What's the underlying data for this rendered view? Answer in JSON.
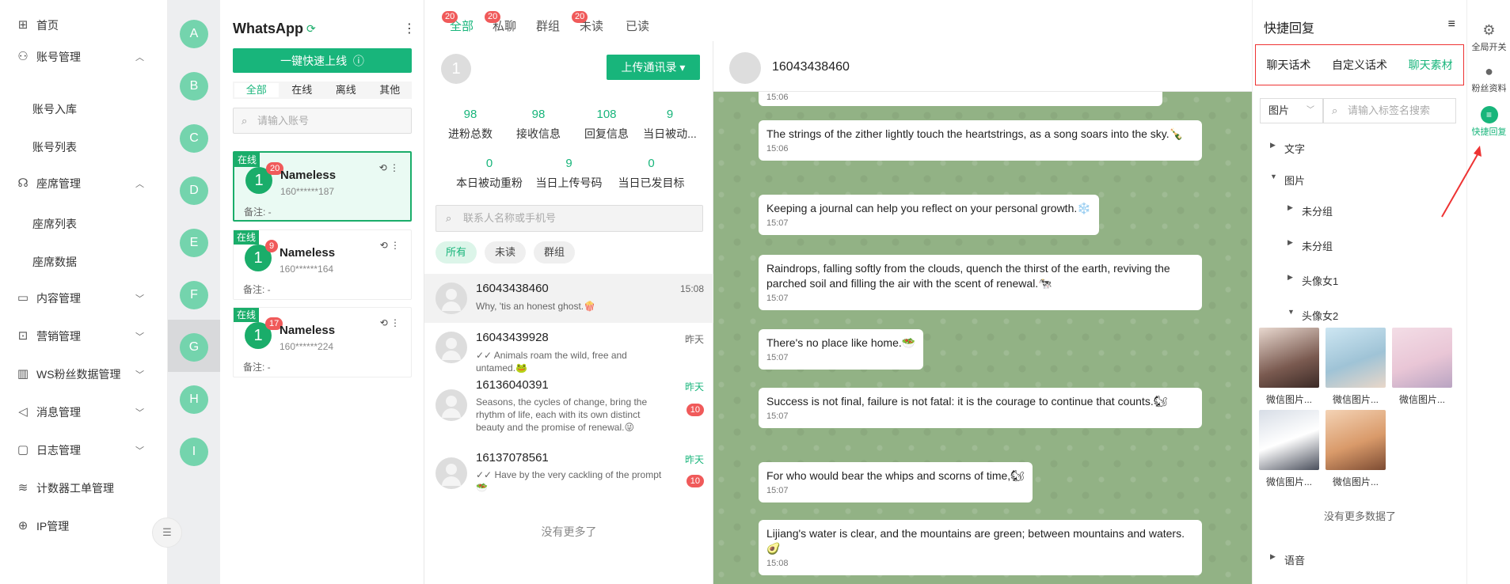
{
  "menu": {
    "home": "首页",
    "account_mgmt": "账号管理",
    "account_import": "账号入库",
    "account_list": "账号列表",
    "seat_mgmt": "座席管理",
    "seat_list": "座席列表",
    "seat_data": "座席数据",
    "content_mgmt": "内容管理",
    "marketing_mgmt": "营销管理",
    "ws_fans_mgmt": "WS粉丝数据管理",
    "message_mgmt": "消息管理",
    "log_mgmt": "日志管理",
    "counter_ticket_mgmt": "计数器工单管理",
    "ip_mgmt": "IP管理"
  },
  "letters": [
    "A",
    "B",
    "C",
    "D",
    "E",
    "F",
    "G",
    "H",
    "I"
  ],
  "accounts": {
    "title": "WhatsApp",
    "quick_online": "一键快速上线",
    "tabs": [
      "全部",
      "在线",
      "离线",
      "其他"
    ],
    "search_placeholder": "请输入账号",
    "cards": [
      {
        "status": "在线",
        "avatar": "1",
        "badge": "20",
        "name": "Nameless",
        "phone": "160******187",
        "note": "备注: -"
      },
      {
        "status": "在线",
        "avatar": "1",
        "badge": "9",
        "name": "Nameless",
        "phone": "160******164",
        "note": "备注: -"
      },
      {
        "status": "在线",
        "avatar": "1",
        "badge": "17",
        "name": "Nameless",
        "phone": "160******224",
        "note": "备注: -"
      }
    ]
  },
  "top_tabs": [
    {
      "label": "全部",
      "badge": "20"
    },
    {
      "label": "私聊",
      "badge": "20"
    },
    {
      "label": "群组",
      "badge": ""
    },
    {
      "label": "未读",
      "badge": "20"
    },
    {
      "label": "已读",
      "badge": ""
    }
  ],
  "list": {
    "avatar": "1",
    "upload_label": "上传通讯录",
    "stats": [
      {
        "value": "98",
        "label": "进粉总数"
      },
      {
        "value": "98",
        "label": "接收信息"
      },
      {
        "value": "108",
        "label": "回复信息"
      },
      {
        "value": "9",
        "label": "当日被动..."
      },
      {
        "value": "0",
        "label": "本日被动重粉"
      },
      {
        "value": "9",
        "label": "当日上传号码"
      },
      {
        "value": "0",
        "label": "当日已发目标"
      }
    ],
    "search_placeholder": "联系人名称或手机号",
    "filters": [
      "所有",
      "未读",
      "群组"
    ],
    "conversations": [
      {
        "name": "16043438460",
        "time": "15:08",
        "msg": "Why, 'tis an honest ghost.🍿",
        "unread": ""
      },
      {
        "name": "16043439928",
        "time": "昨天",
        "msg": "✓✓ Animals roam the wild, free and untamed.🐸",
        "unread": ""
      },
      {
        "name": "16136040391",
        "time": "昨天",
        "msg": "Seasons, the cycles of change, bring the rhythm of life, each with its own distinct beauty and the promise of renewal.😜",
        "unread": "10"
      },
      {
        "name": "16137078561",
        "time": "昨天",
        "msg": "✓✓ Have by the very cackling of the prompt 🥗",
        "unread": "10"
      }
    ],
    "no_more": "没有更多了"
  },
  "chat": {
    "contact": "16043438460",
    "messages": [
      {
        "text": "",
        "time": "15:06"
      },
      {
        "text": "The strings of the zither lightly touch the heartstrings, as a song soars into the sky.🍾",
        "time": "15:06"
      },
      {
        "text": "Keeping a journal can help you reflect on your personal growth.❄️",
        "time": "15:07"
      },
      {
        "text": "Raindrops, falling softly from the clouds, quench the thirst of the earth, reviving the parched soil and filling the air with the scent of renewal.🐄",
        "time": "15:07"
      },
      {
        "text": "There's no place like home.🥗",
        "time": "15:07"
      },
      {
        "text": "Success is not final, failure is not fatal: it is the courage to continue that counts.🐿",
        "time": "15:07"
      },
      {
        "text": "For who would bear the whips and scorns of time,🐿",
        "time": "15:07"
      },
      {
        "text": "Lijiang's water is clear, and the mountains are green; between mountains and waters.🥑",
        "time": "15:08"
      }
    ]
  },
  "quick_reply": {
    "title": "快捷回复",
    "tabs": [
      "聊天话术",
      "自定义话术",
      "聊天素材"
    ],
    "select_value": "图片",
    "search_placeholder": "请输入标签名搜索",
    "tree": {
      "text": "文字",
      "image": "图片",
      "ungrouped1": "未分组",
      "ungrouped2": "未分组",
      "avatar_f1": "头像女1",
      "avatar_f2": "头像女2",
      "voice": "语音"
    },
    "thumbs": [
      "微信图片...",
      "微信图片...",
      "微信图片...",
      "微信图片...",
      "微信图片..."
    ],
    "no_more": "没有更多数据了"
  },
  "rail": {
    "global_switch": "全局开关",
    "fans_profile": "粉丝资料",
    "quick_reply": "快捷回复"
  },
  "colors": {
    "accent": "#18b57b",
    "badge": "#f05a5a",
    "chat_bg": "#92b285",
    "avatar_letter": "#74d4ad"
  }
}
